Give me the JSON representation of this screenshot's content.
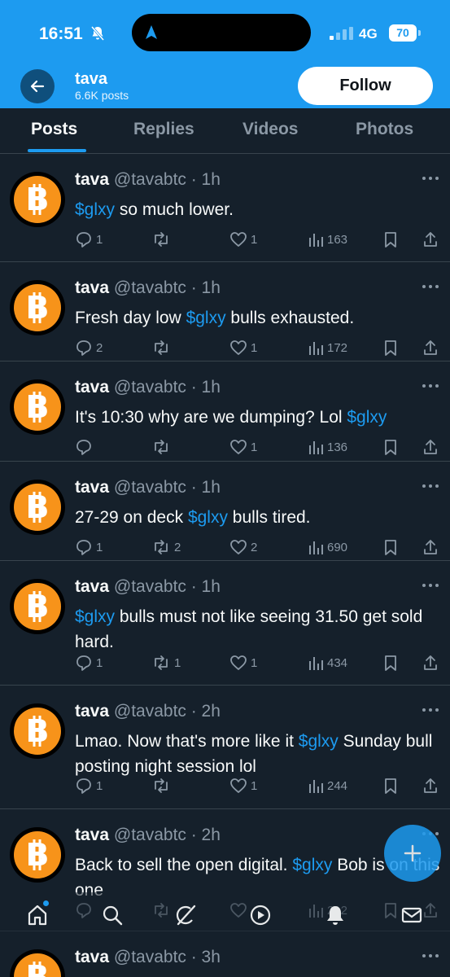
{
  "status_bar": {
    "time": "16:51",
    "network": "4G",
    "battery": "70"
  },
  "header": {
    "name": "tava",
    "posts": "6.6K posts",
    "follow_label": "Follow"
  },
  "tabs": [
    {
      "label": "Posts",
      "active": true
    },
    {
      "label": "Replies",
      "active": false
    },
    {
      "label": "Videos",
      "active": false
    },
    {
      "label": "Photos",
      "active": false
    }
  ],
  "tweets": [
    {
      "name": "tava",
      "meta": "@tavabtc · 1h",
      "text": [
        "$glxy",
        " so much lower."
      ],
      "replies": "1",
      "reposts": "",
      "likes": "1",
      "views": "163"
    },
    {
      "name": "tava",
      "meta": "@tavabtc · 1h",
      "text": [
        "Fresh day low ",
        "$glxy",
        " bulls exhausted."
      ],
      "replies": "2",
      "reposts": "",
      "likes": "1",
      "views": "172"
    },
    {
      "name": "tava",
      "meta": "@tavabtc · 1h",
      "text": [
        "It's 10:30 why are we dumping? Lol ",
        "$glxy"
      ],
      "replies": "",
      "reposts": "",
      "likes": "1",
      "views": "136"
    },
    {
      "name": "tava",
      "meta": "@tavabtc · 1h",
      "text": [
        "27-29 on deck ",
        "$glxy",
        " bulls tired."
      ],
      "replies": "1",
      "reposts": "2",
      "likes": "2",
      "views": "690"
    },
    {
      "name": "tava",
      "meta": "@tavabtc · 1h",
      "text": [
        "$glxy",
        " bulls must not like seeing 31.50 get sold hard."
      ],
      "replies": "1",
      "reposts": "1",
      "likes": "1",
      "views": "434"
    },
    {
      "name": "tava",
      "meta": "@tavabtc · 2h",
      "text": [
        "Lmao. Now that's more like it ",
        "$glxy",
        " Sunday bull posting night session lol"
      ],
      "replies": "1",
      "reposts": "",
      "likes": "1",
      "views": "244"
    },
    {
      "name": "tava",
      "meta": "@tavabtc · 2h",
      "text": [
        "Back to sell the open digital. ",
        "$glxy",
        " Bob is on this one"
      ],
      "replies": "",
      "reposts": "",
      "likes": "",
      "views": "212"
    },
    {
      "name": "tava",
      "meta": "@tavabtc · 3h",
      "text": [],
      "replies": "",
      "reposts": "",
      "likes": "",
      "views": ""
    }
  ],
  "icons": {
    "avatar": "bitcoin-icon",
    "reply": "reply-icon",
    "repost": "repost-icon",
    "like": "like-icon",
    "views": "views-icon",
    "bookmark": "bookmark-icon",
    "share": "share-icon",
    "compose": "compose-icon",
    "nav": [
      "home-icon",
      "search-icon",
      "grok-icon",
      "spaces-icon",
      "notifications-icon",
      "messages-icon"
    ]
  },
  "colors": {
    "accent": "#1d9bf0",
    "background": "#15202b",
    "bitcoin": "#f7931a"
  }
}
